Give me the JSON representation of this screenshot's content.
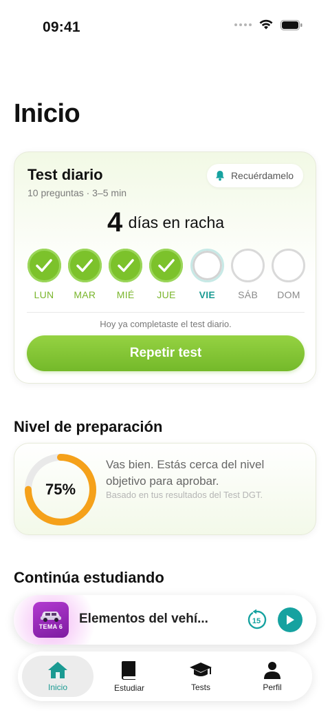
{
  "status_bar": {
    "time": "09:41"
  },
  "page": {
    "title": "Inicio"
  },
  "daily_test": {
    "title": "Test diario",
    "subtitle": "10 preguntas · 3–5 min",
    "remind_label": "Recuérdamelo",
    "streak_count": "4",
    "streak_label": "días en racha",
    "days": [
      {
        "label": "LUN",
        "state": "done"
      },
      {
        "label": "MAR",
        "state": "done"
      },
      {
        "label": "MIÉ",
        "state": "done"
      },
      {
        "label": "JUE",
        "state": "done"
      },
      {
        "label": "VIE",
        "state": "today"
      },
      {
        "label": "SÁB",
        "state": "todo"
      },
      {
        "label": "DOM",
        "state": "todo"
      }
    ],
    "completed_note": "Hoy ya completaste el test diario.",
    "repeat_label": "Repetir test"
  },
  "preparation": {
    "section_title": "Nivel de preparación",
    "percent_label": "75%",
    "progress": 0.75,
    "message": "Vas bien. Estás cerca del nivel objetivo para aprobar.",
    "note": "Basado en tus resultados del Test DGT."
  },
  "continue": {
    "section_title": "Continúa estudiando"
  },
  "mini_player": {
    "thumb_label": "TEMA 6",
    "title": "Elementos del vehí...",
    "skip_label": "15"
  },
  "tabs": [
    {
      "label": "Inicio",
      "icon": "home-icon",
      "active": true
    },
    {
      "label": "Estudiar",
      "icon": "book-icon",
      "active": false
    },
    {
      "label": "Tests",
      "icon": "graduation-cap-icon",
      "active": false
    },
    {
      "label": "Perfil",
      "icon": "person-icon",
      "active": false
    }
  ],
  "colors": {
    "accent_green": "#7cc22b",
    "accent_teal": "#16a2a0",
    "progress_orange": "#f5a11a",
    "player_purple": "#b23ad0"
  }
}
